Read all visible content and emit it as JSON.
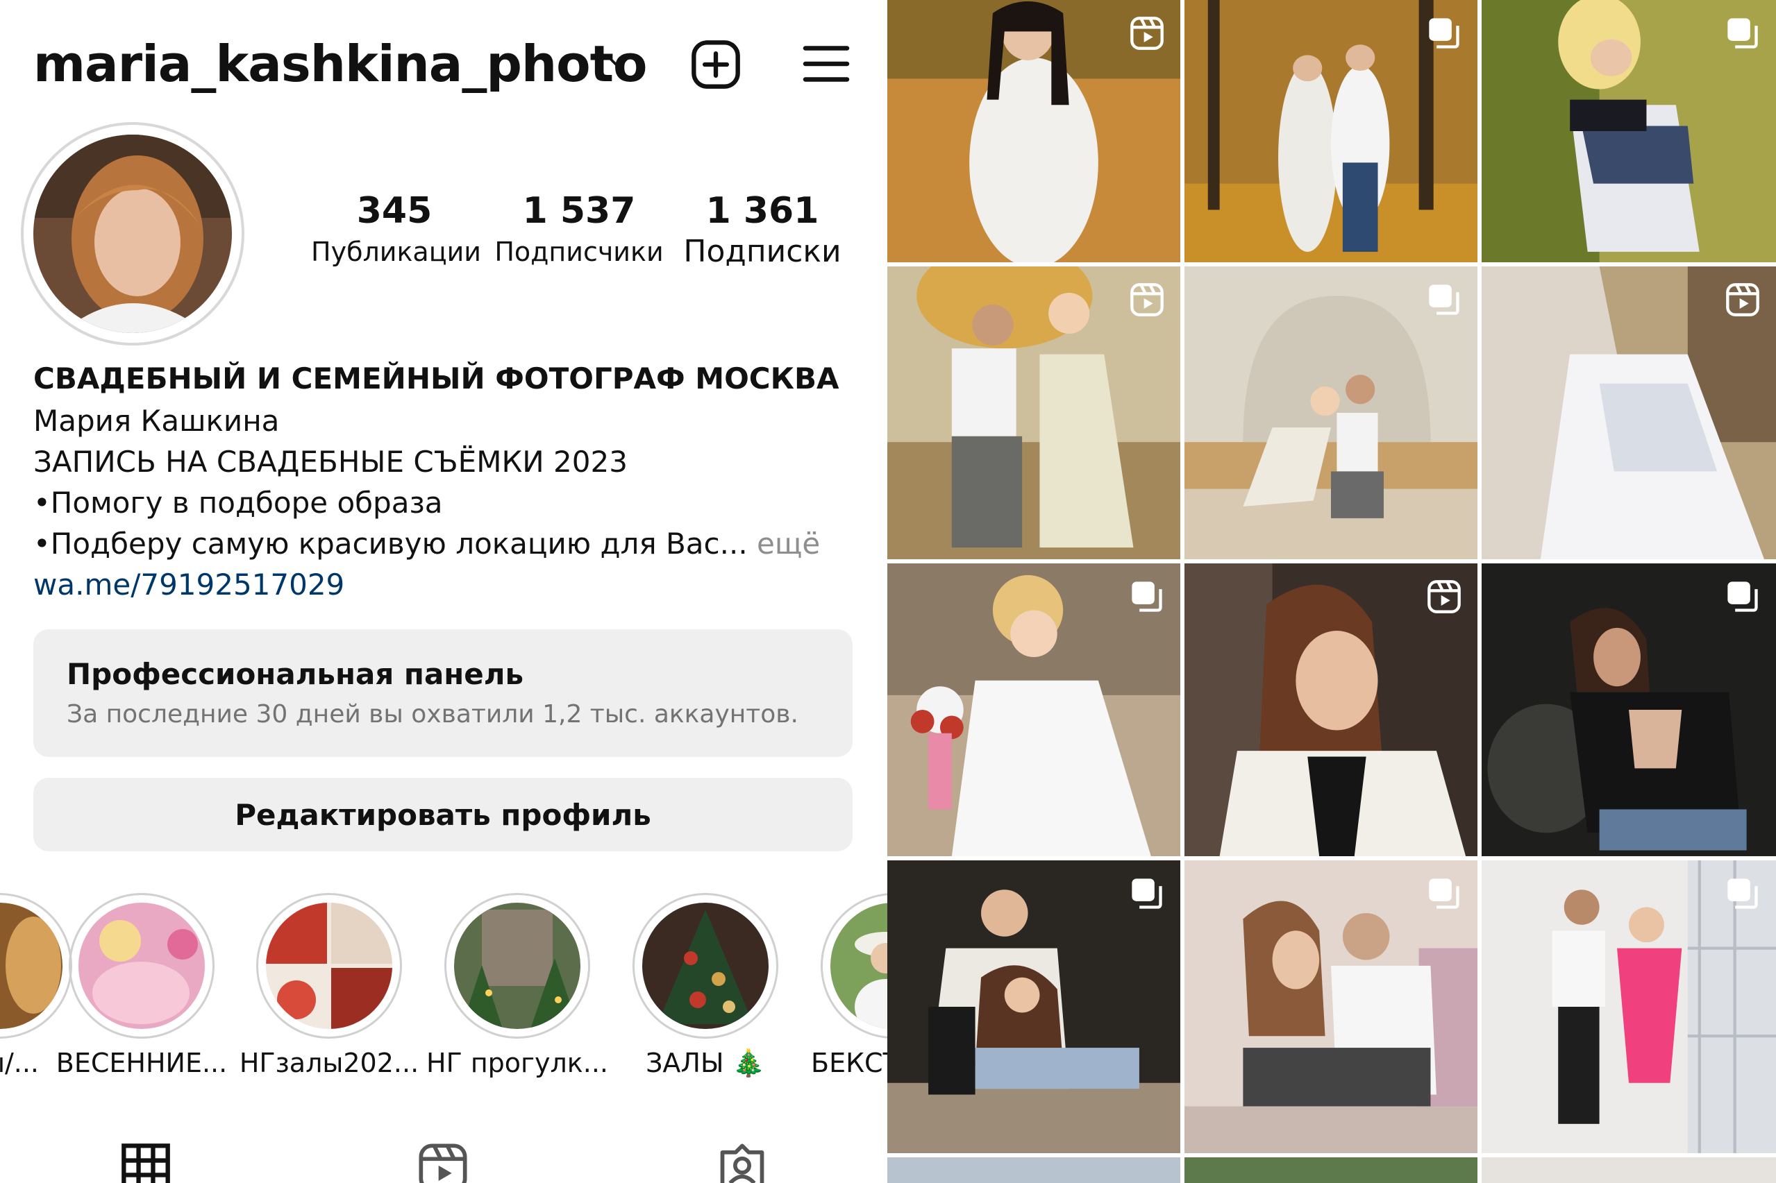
{
  "header": {
    "username": "maria_kashkina_photo"
  },
  "stats": [
    {
      "value": "345",
      "label": "Публикации"
    },
    {
      "value": "1 537",
      "label": "Подписчики"
    },
    {
      "value": "1 361",
      "label": "Подписки"
    }
  ],
  "bio": {
    "title": "СВАДЕБНЫЙ И СЕМЕЙНЫЙ ФОТОГРАФ МОСКВА",
    "name": "Мария Кашкина",
    "line1": "ЗАПИСЬ НА СВАДЕБНЫЕ СЪЁМКИ 2023",
    "line2": "•Помогу в подборе образа",
    "line3": "•Подберу самую красивую локацию для Вас...",
    "more": "ещё",
    "link": "wa.me/79192517029"
  },
  "pro_panel": {
    "title": "Профессиональная панель",
    "subtitle": "За последние 30 дней вы охватили 1,2 тыс. аккаунтов."
  },
  "edit_button": {
    "label": "Редактировать профиль"
  },
  "highlights": [
    {
      "label": "ы/..."
    },
    {
      "label": "ВЕСЕННИЕ..."
    },
    {
      "label": "НГзалы202..."
    },
    {
      "label": "НГ прогулк..."
    },
    {
      "label": "ЗАЛЫ 🎄"
    },
    {
      "label": "БЕКСТ"
    }
  ],
  "tabs": [
    {
      "icon": "grid-icon"
    },
    {
      "icon": "reels-icon"
    },
    {
      "icon": "tagged-icon"
    }
  ],
  "grid": [
    {
      "badge": "reel"
    },
    {
      "badge": "carousel"
    },
    {
      "badge": "carousel"
    },
    {
      "badge": "reel"
    },
    {
      "badge": "carousel"
    },
    {
      "badge": "reel"
    },
    {
      "badge": "carousel"
    },
    {
      "badge": "reel"
    },
    {
      "badge": "carousel"
    },
    {
      "badge": "carousel"
    },
    {
      "badge": "carousel"
    },
    {
      "badge": "carousel"
    }
  ],
  "colors": {
    "link": "#00376b",
    "muted": "#8e8e8e",
    "panel_bg": "#efefef"
  }
}
